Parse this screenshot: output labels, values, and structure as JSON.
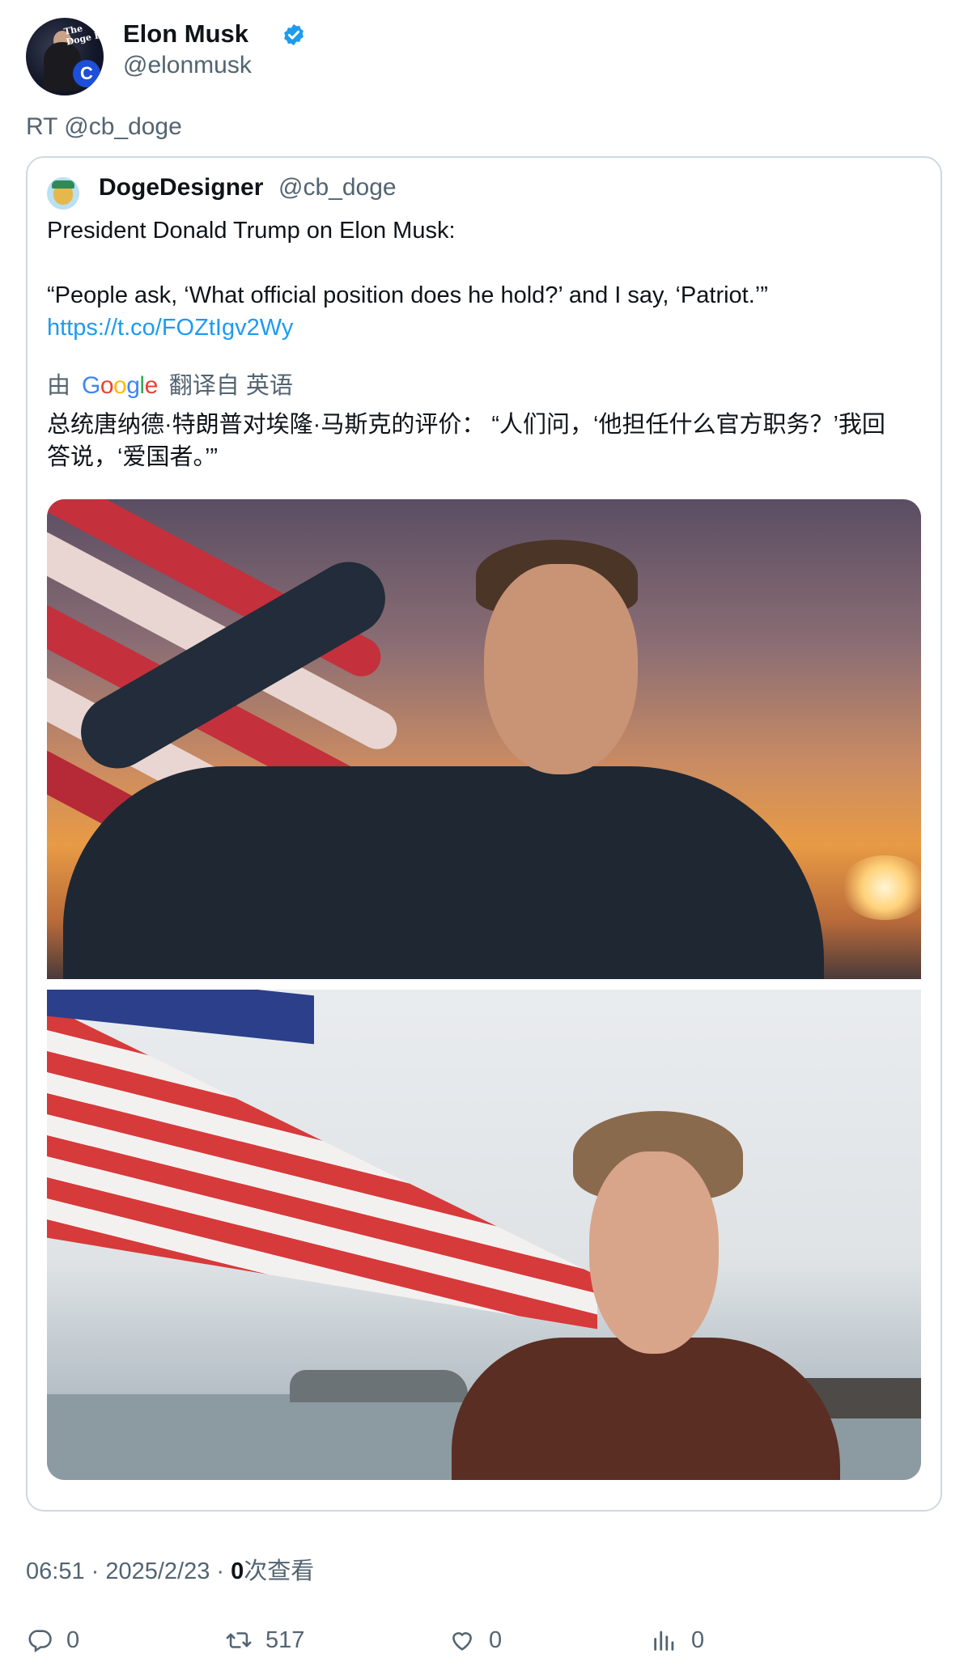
{
  "author": {
    "display_name": "Elon Musk",
    "handle": "@elonmusk",
    "avatar_text": "The Doge F",
    "avatar_badge": "C",
    "verified": true
  },
  "retweet_line": "RT @cb_doge",
  "quoted": {
    "display_name": "DogeDesigner",
    "handle": "@cb_doge",
    "text_line1": "President Donald Trump on Elon Musk:",
    "text_line2": "“People ask, ‘What official position does he hold?’ and I say, ‘Patriot.’”",
    "link": "https://t.co/FOZtIgv2Wy",
    "translate_prefix": "由",
    "translate_provider": "Google",
    "translate_suffix": "翻译自 英语",
    "translated_text": "总统唐纳德·特朗普对埃隆·马斯克的评价： “人们问，‘他担任什么官方职务？’我回答说，‘爱国者。’”"
  },
  "meta": {
    "time": "06:51",
    "separator": " · ",
    "date": "2025/2/23",
    "views_count": "0",
    "views_label": "次查看"
  },
  "actions": {
    "replies": "0",
    "retweets": "517",
    "likes": "0",
    "views": "0"
  },
  "colors": {
    "link": "#1d9bf0",
    "secondary_text": "#536471",
    "verified": "#1d9bf0"
  }
}
